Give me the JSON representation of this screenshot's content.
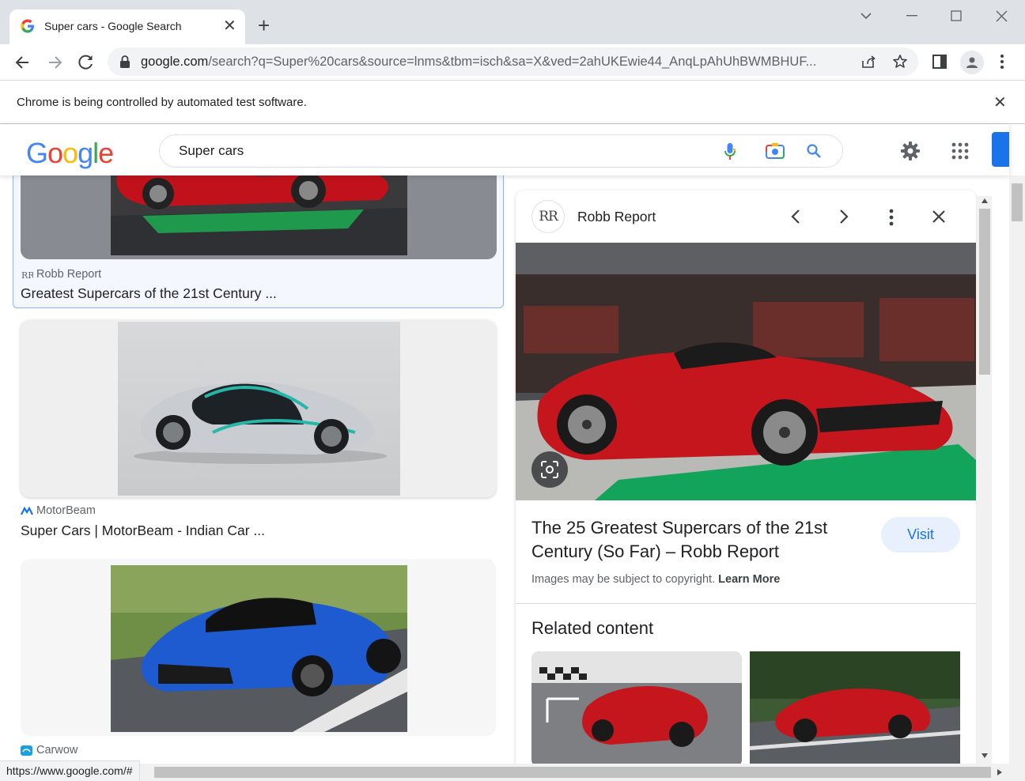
{
  "browser": {
    "tab_title": "Super cars - Google Search",
    "url_host": "google.com",
    "url_rest": "/search?q=Super%20cars&source=lnms&tbm=isch&sa=X&ved=2ahUKEwie44_AnqLpAhUhBWMBHUF...",
    "infobar_message": "Chrome is being controlled by automated test software.",
    "status_url": "https://www.google.com/#"
  },
  "google": {
    "logo_letters": [
      "G",
      "o",
      "o",
      "g",
      "l",
      "e"
    ],
    "logo_colors": [
      "#4285F4",
      "#EA4335",
      "#FBBC05",
      "#4285F4",
      "#34A853",
      "#EA4335"
    ],
    "search_query": "Super cars"
  },
  "results": [
    {
      "source": "Robb Report",
      "caption": "Greatest Supercars of the 21st Century ..."
    },
    {
      "source": "MotorBeam",
      "caption": "Super Cars | MotorBeam - Indian Car ..."
    },
    {
      "source": "Carwow"
    }
  ],
  "preview": {
    "source_initials": "RR",
    "source_name": "Robb Report",
    "title_line1": "The 25 Greatest Supercars of the 21st",
    "title_line2": "Century (So Far) – Robb Report",
    "visit_label": "Visit",
    "copyright_text": "Images may be subject to copyright.",
    "learn_more": "Learn More",
    "related_heading": "Related content"
  },
  "colors": {
    "accent_blue": "#1a73e8",
    "visit_bg": "#e8f0fe",
    "ferrari_red": "#c4161c"
  }
}
